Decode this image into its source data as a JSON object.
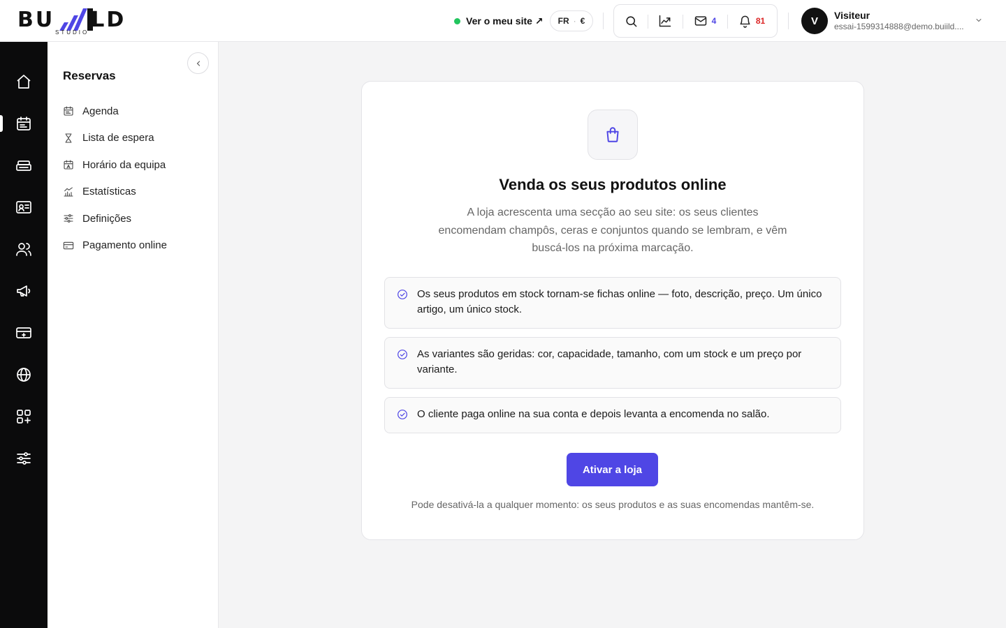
{
  "header": {
    "logo_text_left": "BU",
    "logo_text_right": "LD",
    "logo_subtitle": "STUDIO",
    "site_link": "Ver o meu site ↗",
    "lang": "FR",
    "currency": "€",
    "messages_count": "4",
    "notifications_count": "81",
    "user": {
      "initial": "V",
      "name": "Visiteur",
      "email": "essai-1599314888@demo.buiild...."
    }
  },
  "rail": {
    "items": [
      {
        "icon": "home-icon"
      },
      {
        "icon": "calendar-icon",
        "active": true
      },
      {
        "icon": "register-icon"
      },
      {
        "icon": "contact-card-icon"
      },
      {
        "icon": "users-icon"
      },
      {
        "icon": "megaphone-icon"
      },
      {
        "icon": "ticket-icon"
      },
      {
        "icon": "globe-icon"
      },
      {
        "icon": "apps-icon"
      },
      {
        "icon": "settings-sliders-icon"
      }
    ]
  },
  "subnav": {
    "title": "Reservas",
    "items": [
      {
        "label": "Agenda",
        "icon": "calendar-icon"
      },
      {
        "label": "Lista de espera",
        "icon": "hourglass-icon"
      },
      {
        "label": "Horário da equipa",
        "icon": "team-schedule-icon"
      },
      {
        "label": "Estatísticas",
        "icon": "stats-icon"
      },
      {
        "label": "Definições",
        "icon": "sliders-icon"
      },
      {
        "label": "Pagamento online",
        "icon": "credit-card-icon"
      }
    ]
  },
  "card": {
    "icon": "shopping-bag-icon",
    "title": "Venda os seus produtos online",
    "description": "A loja acrescenta uma secção ao seu site: os seus clientes encomendam champôs, ceras e conjuntos quando se lembram, e vêm buscá-los na próxima marcação.",
    "features": [
      "Os seus produtos em stock tornam-se fichas online — foto, descrição, preço. Um único artigo, um único stock.",
      "As variantes são geridas: cor, capacidade, tamanho, com um stock e um preço por variante.",
      "O cliente paga online na sua conta e depois levanta a encomenda no salão."
    ],
    "cta_label": "Ativar a loja",
    "footnote": "Pode desativá-la a qualquer momento: os seus produtos e as suas encomendas mantêm-se."
  },
  "colors": {
    "accent": "#4f46e5",
    "rail_bg": "#0b0b0c",
    "status_green": "#22c55e",
    "notification_red": "#dc2626"
  }
}
